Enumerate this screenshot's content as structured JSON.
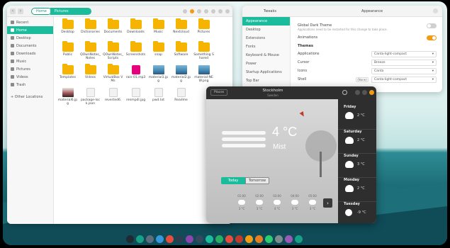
{
  "files": {
    "path_home": "Home",
    "path_current": "Pictures",
    "sidebar": [
      {
        "label": "Recent",
        "icon": "clock-icon"
      },
      {
        "label": "Home",
        "icon": "home-icon",
        "active": true
      },
      {
        "label": "Desktop",
        "icon": "desktop-icon"
      },
      {
        "label": "Documents",
        "icon": "document-icon"
      },
      {
        "label": "Downloads",
        "icon": "download-icon"
      },
      {
        "label": "Music",
        "icon": "music-icon"
      },
      {
        "label": "Pictures",
        "icon": "picture-icon"
      },
      {
        "label": "Videos",
        "icon": "video-icon"
      },
      {
        "label": "Trash",
        "icon": "trash-icon"
      }
    ],
    "other_locations": "+ Other Locations",
    "items": [
      {
        "name": "Desktop",
        "kind": "folder"
      },
      {
        "name": "Dictionaries",
        "kind": "folder"
      },
      {
        "name": "Documents",
        "kind": "folder"
      },
      {
        "name": "Downloads",
        "kind": "folder"
      },
      {
        "name": "Music",
        "kind": "folder"
      },
      {
        "name": "Nextcloud",
        "kind": "folder"
      },
      {
        "name": "Pictures",
        "kind": "folder"
      },
      {
        "name": "Public",
        "kind": "folder"
      },
      {
        "name": "QOwnNotes_Notes",
        "kind": "folder"
      },
      {
        "name": "QOwnNotes_Scripts",
        "kind": "folder"
      },
      {
        "name": "Screenshots",
        "kind": "folder"
      },
      {
        "name": "snap",
        "kind": "folder"
      },
      {
        "name": "Software",
        "kind": "folder"
      },
      {
        "name": "Something Shared",
        "kind": "folder"
      },
      {
        "name": "Templates",
        "kind": "folder"
      },
      {
        "name": "Videos",
        "kind": "folder"
      },
      {
        "name": "VirtualBox VMs",
        "kind": "folder"
      },
      {
        "name": "rain-01.mp3",
        "kind": "mp3"
      },
      {
        "name": "material1.jpg",
        "kind": "image"
      },
      {
        "name": "material2.jpg",
        "kind": "image"
      },
      {
        "name": "material-NEW.png",
        "kind": "image"
      },
      {
        "name": "material6.jpg",
        "kind": "image2"
      },
      {
        "name": "package-lock.json",
        "kind": "doc"
      },
      {
        "name": "reverted6.",
        "kind": "doc"
      },
      {
        "name": "renmpdl.jpg",
        "kind": "doc"
      },
      {
        "name": "pwd.txt",
        "kind": "doc"
      },
      {
        "name": "Readme",
        "kind": "doc"
      }
    ]
  },
  "settings": {
    "title_left": "Tweaks",
    "title_right": "Appearance",
    "nav": [
      "Appearance",
      "Desktop",
      "Extensions",
      "Fonts",
      "Keyboard & Mouse",
      "Power",
      "Startup Applications",
      "Top Bar"
    ],
    "global_dark_theme": "Global Dark Theme",
    "global_dark_sub": "Applications need to be restarted for this change to take place.",
    "animations": "Animations",
    "themes_header": "Themes",
    "rows": [
      {
        "label": "Applications",
        "value": "Canta-light-compact"
      },
      {
        "label": "Cursor",
        "value": "Breeze"
      },
      {
        "label": "Icons",
        "value": "Canta"
      },
      {
        "label": "Shell",
        "value": "Canta-light-compact"
      }
    ],
    "shell_mini": "(None)"
  },
  "weather": {
    "places_button": "Places",
    "location": "Stockholm",
    "location_sub": "Sweden",
    "temperature": "4 °C",
    "condition": "Mist",
    "tab_today": "Today",
    "tab_tomorrow": "Tomorrow",
    "hours": [
      {
        "time": "01:00",
        "temp": "3 °C"
      },
      {
        "time": "02:00",
        "temp": "3 °C"
      },
      {
        "time": "03:00",
        "temp": "4 °C"
      },
      {
        "time": "04:00",
        "temp": "3 °C"
      },
      {
        "time": "05:00",
        "temp": "3 °C"
      }
    ],
    "next_button": "›",
    "days": [
      {
        "name": "Friday",
        "temp": "2 °C",
        "icon": "cloud-icon"
      },
      {
        "name": "Saturday",
        "temp": "2 °C",
        "icon": "cloud-icon"
      },
      {
        "name": "Sunday",
        "temp": "3 °C",
        "icon": "cloud-icon"
      },
      {
        "name": "Monday",
        "temp": "2 °C",
        "icon": "cloud-icon"
      },
      {
        "name": "Tuesday",
        "temp": "-9 °C",
        "icon": "sun-icon"
      }
    ]
  },
  "dock": {
    "colors": [
      "#1f2a33",
      "#16a085",
      "#5d6d7e",
      "#3498db",
      "#e74c3c",
      "#2c3e50",
      "#8e44ad",
      "#34495e",
      "#1abc9c",
      "#27ae60",
      "#e74c3c",
      "#c0392b",
      "#f39c12",
      "#e67e22",
      "#2ecc71",
      "#7f8c8d",
      "#9b59b6",
      "#16a085"
    ]
  },
  "accent": "#1abc9c"
}
